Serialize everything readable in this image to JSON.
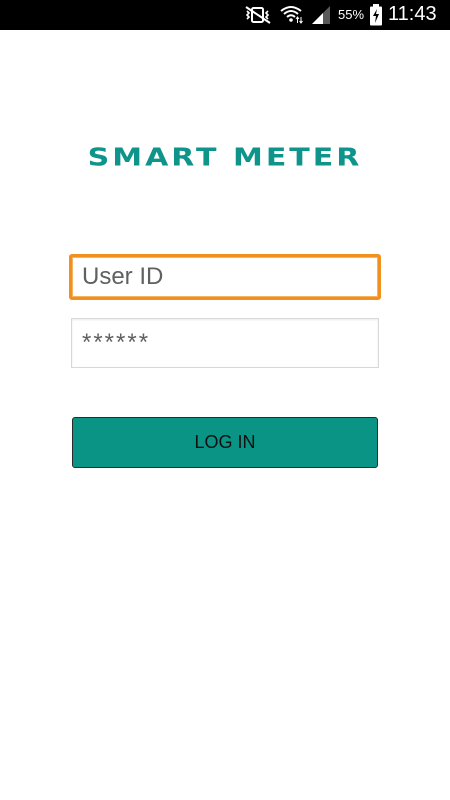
{
  "status_bar": {
    "battery_percent": "55%",
    "time": "11:43",
    "icons": [
      "mute-vibrate-icon",
      "wifi-icon",
      "signal-icon",
      "battery-charging-icon"
    ]
  },
  "app": {
    "logo_text": "SMART METER"
  },
  "login_form": {
    "user_id_placeholder": "User ID",
    "password_placeholder": "******",
    "login_label": "LOG IN"
  },
  "colors": {
    "brand_teal": "#099485",
    "focus_orange": "#f0901e",
    "status_bar_bg": "#000000"
  }
}
